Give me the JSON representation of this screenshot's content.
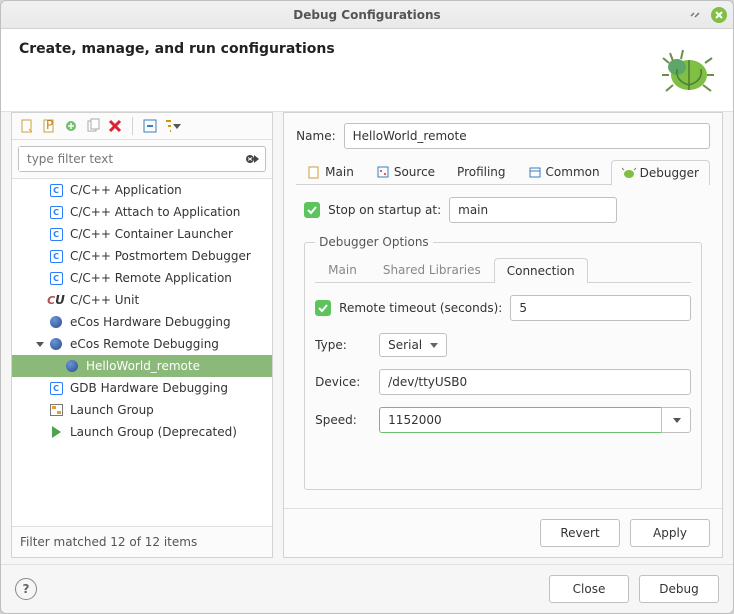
{
  "window": {
    "title": "Debug Configurations"
  },
  "header": {
    "title": "Create, manage, and run configurations"
  },
  "filter": {
    "placeholder": "type filter text"
  },
  "tree": {
    "items": [
      {
        "label": "C/C++ Application",
        "icon": "c"
      },
      {
        "label": "C/C++ Attach to Application",
        "icon": "c"
      },
      {
        "label": "C/C++ Container Launcher",
        "icon": "c"
      },
      {
        "label": "C/C++ Postmortem Debugger",
        "icon": "c"
      },
      {
        "label": "C/C++ Remote Application",
        "icon": "c"
      },
      {
        "label": "C/C++ Unit",
        "icon": "cu"
      },
      {
        "label": "eCos Hardware Debugging",
        "icon": "ball"
      },
      {
        "label": "eCos Remote Debugging",
        "icon": "ball",
        "expanded": true,
        "children": [
          {
            "label": "HelloWorld_remote",
            "icon": "ball",
            "selected": true
          }
        ]
      },
      {
        "label": "GDB Hardware Debugging",
        "icon": "c"
      },
      {
        "label": "Launch Group",
        "icon": "grp"
      },
      {
        "label": "Launch Group (Deprecated)",
        "icon": "play"
      }
    ]
  },
  "filter_status": "Filter matched 12 of 12 items",
  "form": {
    "name_label": "Name:",
    "name_value": "HelloWorld_remote",
    "tabs": [
      "Main",
      "Source",
      "Profiling",
      "Common",
      "Debugger"
    ],
    "active_tab": "Debugger",
    "debugger": {
      "stop_label": "Stop on startup at:",
      "stop_value": "main",
      "opts_legend": "Debugger Options",
      "subtabs": [
        "Main",
        "Shared Libraries",
        "Connection"
      ],
      "active_subtab": "Connection",
      "connection": {
        "remote_timeout_label": "Remote timeout (seconds):",
        "remote_timeout_value": "5",
        "type_label": "Type:",
        "type_value": "Serial",
        "device_label": "Device:",
        "device_value": "/dev/ttyUSB0",
        "speed_label": "Speed:",
        "speed_value": "1152000"
      }
    },
    "revert": "Revert",
    "apply": "Apply"
  },
  "footer": {
    "close": "Close",
    "debug": "Debug"
  }
}
